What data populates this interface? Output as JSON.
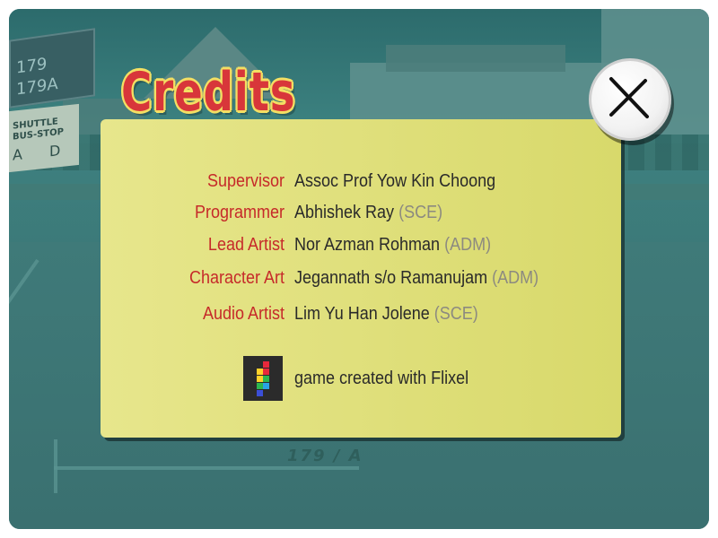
{
  "title": "Credits",
  "credits": [
    {
      "role": "Supervisor",
      "name": "Assoc Prof Yow Kin Choong",
      "dept": ""
    },
    {
      "role": "Programmer",
      "name": "Abhishek Ray",
      "dept": "(SCE)"
    },
    {
      "role": "Lead Artist",
      "name": "Nor Azman Rohman",
      "dept": "(ADM)"
    },
    {
      "role": "Character Art",
      "name": "Jegannath s/o Ramanujam",
      "dept": "(ADM)"
    },
    {
      "role": "Audio Artist",
      "name": "Lim Yu Han Jolene",
      "dept": "(SCE)"
    }
  ],
  "flixel": {
    "text": "game created with Flixel",
    "icon": "flixel-logo-icon"
  },
  "close": {
    "icon": "close-icon"
  },
  "background": {
    "bus_numbers": [
      "179",
      "179A"
    ],
    "stop_sign": [
      "SHUTTLE",
      "BUS-STOP"
    ],
    "stop_letters": [
      "A",
      "D"
    ],
    "road_marking": "179 / A"
  },
  "colors": {
    "panel": "#e2e27f",
    "role_text": "#c62a2a",
    "name_text": "#2a2a2a",
    "dept_text": "#8c8a80",
    "title": "#d8363a",
    "title_outline": "#f3df63"
  }
}
